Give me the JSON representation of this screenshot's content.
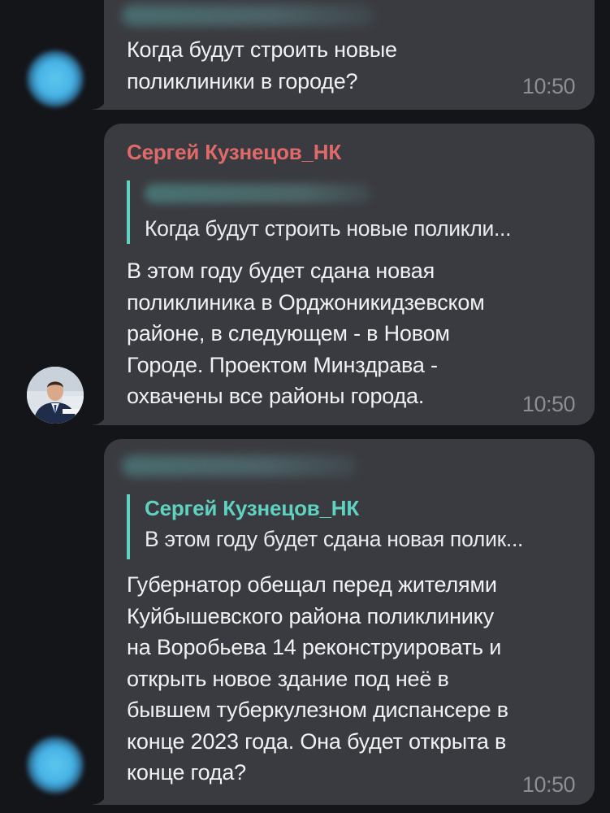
{
  "messages": [
    {
      "text": "Когда будут строить новые\nполиклиники в городе?",
      "time": "10:50"
    },
    {
      "sender": "Сергей Кузнецов_НК",
      "reply_text": "Когда будут строить новые поликли...",
      "text": "В этом году будет сдана новая\nполиклиника в Орджоникидзевском\nрайоне, в следующем - в Новом\nГороде. Проектом  Минздрава -\nохвачены все районы города.",
      "time": "10:50"
    },
    {
      "reply_name": "Сергей Кузнецов_НК",
      "reply_text": "В этом году будет сдана новая полик...",
      "text": "Губернатор обещал перед жителями\nКуйбышевского района поликлинику\nна Воробьева 14 реконструировать и\nоткрыть новое здание под неё в\nбывшем туберкулезном диспансере в\nконце 2023 года. Она будет открыта в\nконце года?",
      "time": "10:50"
    }
  ],
  "colors": {
    "background": "#141519",
    "bubble": "#3a3b40",
    "sender_name": "#e06a6a",
    "reply_accent": "#5fd2c0",
    "time": "#8b8e95"
  }
}
